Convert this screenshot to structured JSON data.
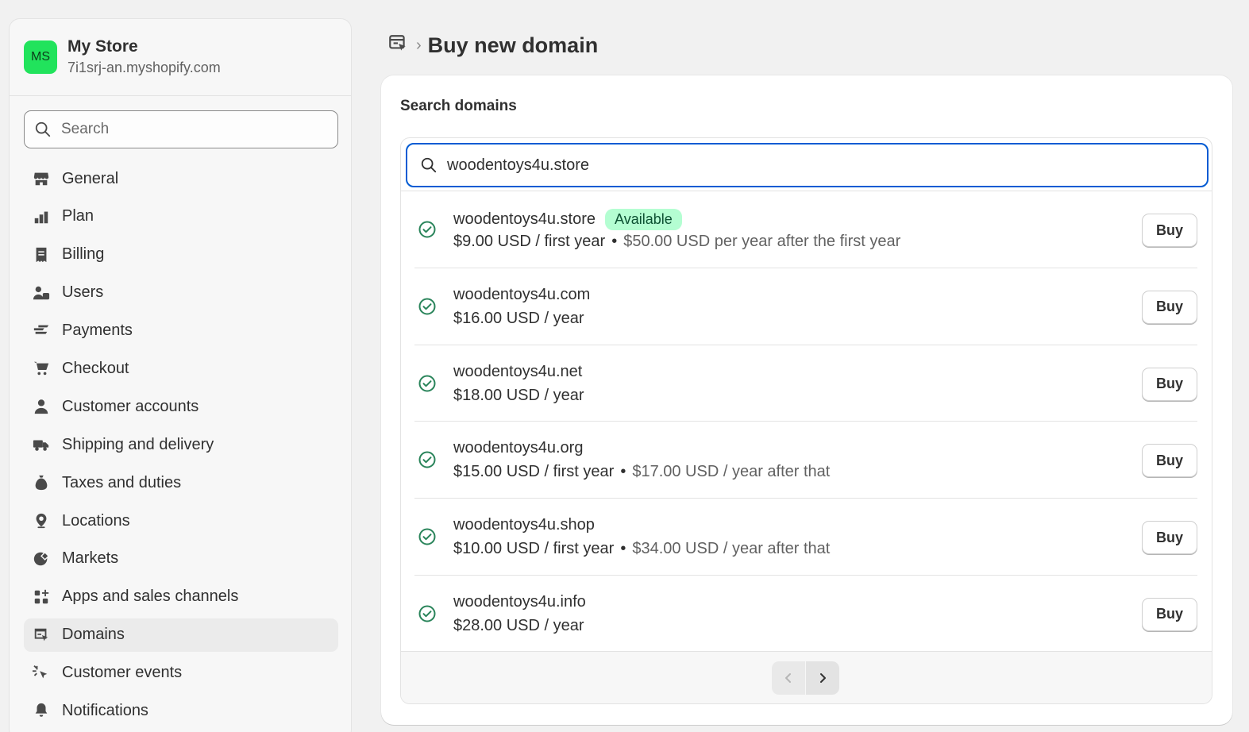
{
  "store": {
    "initials": "MS",
    "name": "My Store",
    "url": "7i1srj-an.myshopify.com"
  },
  "sidebar": {
    "search_placeholder": "Search",
    "items": [
      {
        "label": "General",
        "icon": "store-icon"
      },
      {
        "label": "Plan",
        "icon": "plan-icon"
      },
      {
        "label": "Billing",
        "icon": "receipt-icon"
      },
      {
        "label": "Users",
        "icon": "users-icon"
      },
      {
        "label": "Payments",
        "icon": "payments-icon"
      },
      {
        "label": "Checkout",
        "icon": "cart-icon"
      },
      {
        "label": "Customer accounts",
        "icon": "person-icon"
      },
      {
        "label": "Shipping and delivery",
        "icon": "truck-icon"
      },
      {
        "label": "Taxes and duties",
        "icon": "money-bag-icon"
      },
      {
        "label": "Locations",
        "icon": "location-icon"
      },
      {
        "label": "Markets",
        "icon": "globe-icon"
      },
      {
        "label": "Apps and sales channels",
        "icon": "apps-icon"
      },
      {
        "label": "Domains",
        "icon": "domain-icon",
        "active": true
      },
      {
        "label": "Customer events",
        "icon": "cursor-click-icon"
      },
      {
        "label": "Notifications",
        "icon": "bell-icon"
      }
    ]
  },
  "header": {
    "title": "Buy new domain"
  },
  "card": {
    "title": "Search domains",
    "search_value": "woodentoys4u.store"
  },
  "results": [
    {
      "domain": "woodentoys4u.store",
      "badge": "Available",
      "price": "$9.00 USD / first year",
      "renewal": "$50.00 USD per year after the first year",
      "buy_label": "Buy"
    },
    {
      "domain": "woodentoys4u.com",
      "badge": "",
      "price": "$16.00 USD / year",
      "renewal": "",
      "buy_label": "Buy"
    },
    {
      "domain": "woodentoys4u.net",
      "badge": "",
      "price": "$18.00 USD / year",
      "renewal": "",
      "buy_label": "Buy"
    },
    {
      "domain": "woodentoys4u.org",
      "badge": "",
      "price": "$15.00 USD / first year",
      "renewal": "$17.00 USD / year after that",
      "buy_label": "Buy"
    },
    {
      "domain": "woodentoys4u.shop",
      "badge": "",
      "price": "$10.00 USD / first year",
      "renewal": "$34.00 USD / year after that",
      "buy_label": "Buy"
    },
    {
      "domain": "woodentoys4u.info",
      "badge": "",
      "price": "$28.00 USD / year",
      "renewal": "",
      "buy_label": "Buy"
    }
  ],
  "colors": {
    "accent": "#005bd3",
    "badge_bg": "#b4fed2",
    "check": "#29845a",
    "avatar": "#21e35c"
  }
}
